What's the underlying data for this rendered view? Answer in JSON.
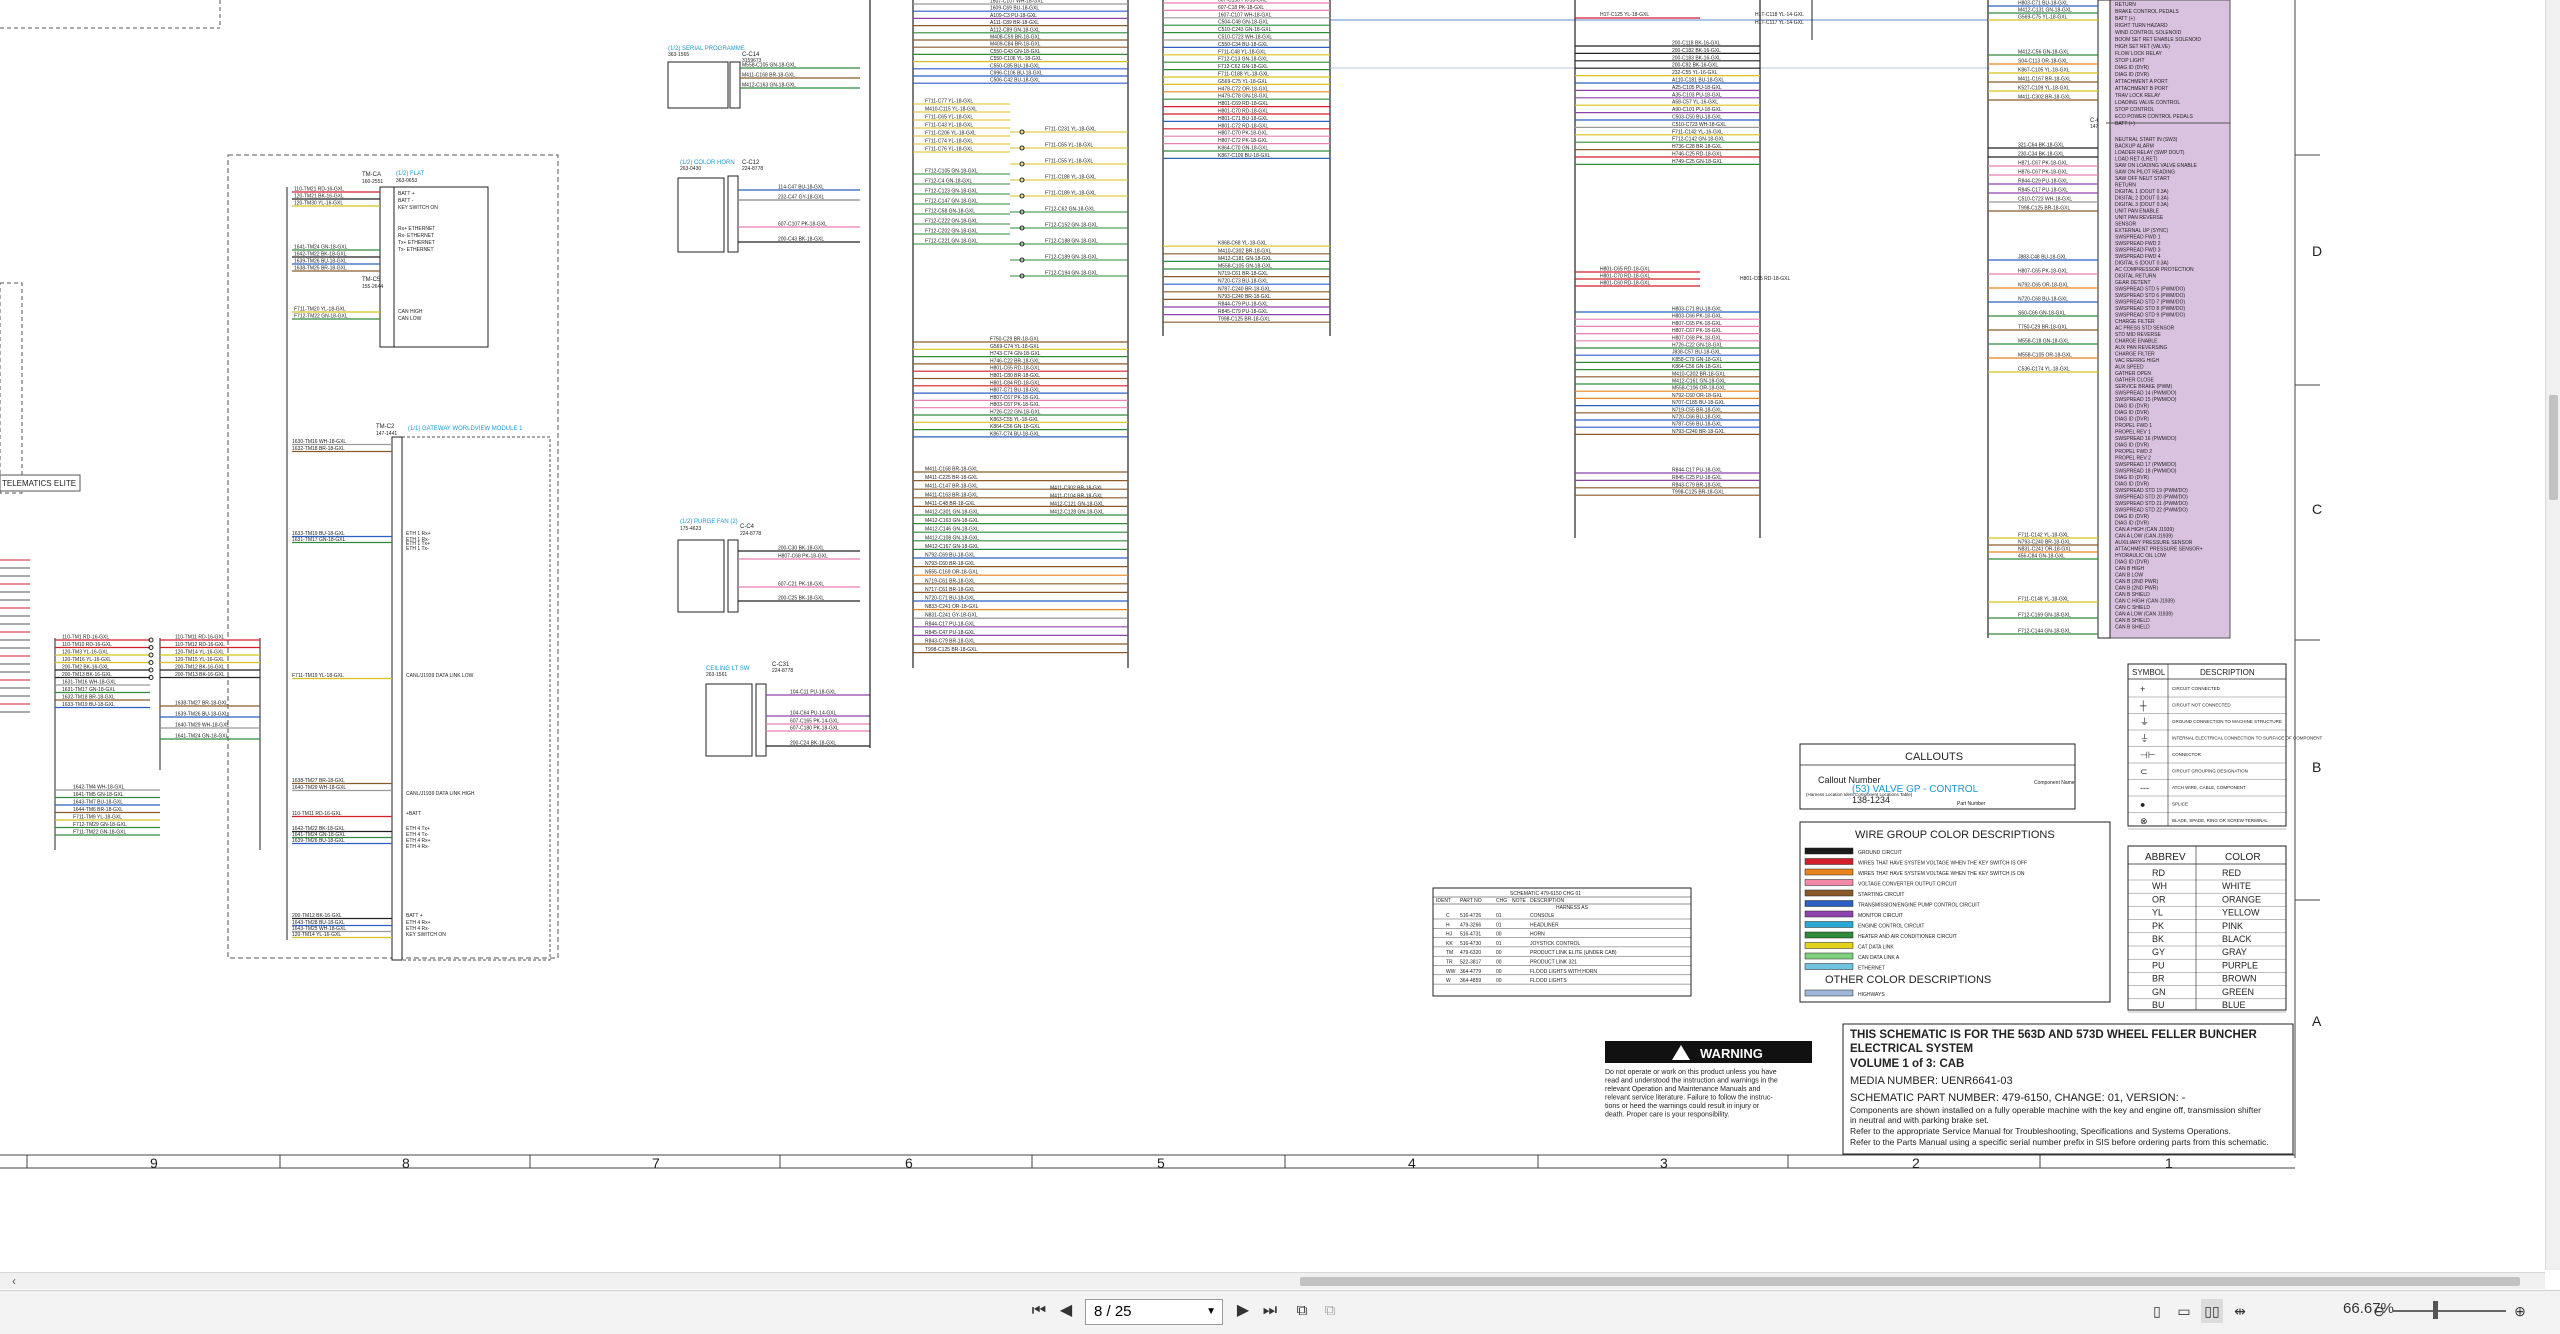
{
  "colors": {
    "purple_fill": "#d9c2df",
    "cyan_link": "#1a9ad6",
    "red_wire": "#d21f2b",
    "panel_bg": "#ffffff"
  },
  "schematic": {
    "labels": {
      "telematics": "TELEMATICS ELITE",
      "tm_ca_id": "TM-CA",
      "tm_ca_part": "160-2551",
      "tm_ca_flat": "(1/2) FLAT",
      "tm_ca_part2": "363-0653",
      "tm_c5": "TM-C5",
      "tm_c5_part": "155-2644",
      "tm_c2": "TM-C2",
      "tm_c2_part": "147-1441",
      "tm_module": "(1/1) GATEWAY WORLDVIEW MODULE 1",
      "serial_prog": "(1/2) SERIAL PROGRAMME",
      "serial_prog_part": "363-1565",
      "c14": "C-C14",
      "c14_part": "3159673",
      "color_horn": "(1/2) COLOR HORN",
      "color_horn_part": "263-0430",
      "c12": "C-C12",
      "c12_part": "224-8778",
      "purge_fan": "(1/2) PURGE FAN (2)",
      "purge_fan_part": "175-4623",
      "c4": "C-C4",
      "c4_part": "224-8778",
      "ceiling_lt": "CEILING LT SW",
      "ceiling_lt_part": "263-1561",
      "c31": "C-C31",
      "c31_part": "224-8778",
      "cs_id": "C-CS",
      "cs_part": "147-1441",
      "horn_hi": "H1T-C125 YL-18-GXL",
      "c118": "H1T-C118 YL-14-GXL",
      "c117": "H1T-C117 YL-14-GXL",
      "h801c65": "H801-C65 RD-18-GXL"
    },
    "tm_pins": [
      "BATT +",
      "BATT -",
      "KEY SWITCH ON",
      "",
      "",
      "Rx+ ETHERNET",
      "Rx- ETHERNET",
      "Tx+ ETHERNET",
      "Tx- ETHERNET"
    ],
    "tm_can": [
      "CAN HIGH",
      "CAN LOW"
    ],
    "tm_wires_top": [
      "110-TM21 RD-16-GXL",
      "120-TM21 BK-16-GXL",
      "120-TM30 YL-16-GXL"
    ],
    "tm_wires_eth": [
      "1641-TM24 GN-18-GXL",
      "1642-TM22 BK-18-GXL",
      "1639-TM26 BU-18-GXL",
      "1638-TM25 BR-18-GXL"
    ],
    "tm_wires_can": [
      "F711-TM20 YL-18-GXL",
      "F712-TM22 GN-18-GXL"
    ],
    "module_pins": [
      "CANL/J1939 DATA LINK LOW",
      "CANL/J1939 DATA LINK HIGH",
      "ETH 1 Rx+",
      "ETH 1 Rx-",
      "ETH 1 Tx+",
      "ETH 1 Tx-",
      "+BATT",
      "ETH 4 Tx+",
      "ETH 4 Tx-",
      "ETH 4 Rx+",
      "ETH 4 Rx-",
      "BATT +",
      "ETH 4 Rx+",
      "ETH 4 Rx-",
      "KEY SWITCH ON"
    ],
    "module_left_wires": [
      "1630-TM16 WH-18-GXL",
      "1632-TM18 BR-18-GXL",
      "1633-TM19 BU-18-GXL",
      "1631-TM17 GN-18-GXL",
      "F711-TM19 YL-18-GXL",
      "1638-TM27 BR-18-GXL",
      "1640-TM29 WH-18-GXL",
      "110-TM11 RD-16-GXL",
      "1642-TM22 BK-18-GXL",
      "1641-TM24 GN-18-GXL",
      "1639-TM26 BU-18-GXL",
      "200-TM12 BK-16-GXL",
      "1643-TM28 BU-18-GXL",
      "1643-TM25 WH-18-GXL",
      "120-TM14 YL-16-GXL"
    ],
    "lower_left_wires": [
      "110-TM1 RD-16-GXL",
      "110-TM10 RD-16-GXL",
      "120-TM3 YL-16-GXL",
      "120-TM16 YL-16-GXL",
      "200-TM2 BK-16-GXL",
      "200-TM13 BK-16-GXL",
      "1631-TM16 WH-18-GXL",
      "1631-TM17 GN-18-GXL",
      "1632-TM18 BR-18-GXL",
      "1633-TM19 BU-18-GXL"
    ],
    "lower_left_wires_b": [
      "1642-TM4 WH-18-GXL",
      "1641-TM5 GN-18-GXL",
      "1643-TM7 BU-18-GXL",
      "1644-TM6 BR-18-GXL",
      "F711-TM9 YL-18-GXL",
      "F712-TM29 GN-18-GXL",
      "F711-TM22 GN-18-GXL"
    ],
    "lower_left_right": [
      "110-TM11 RD-16-GXL",
      "110-TM12 RD-16-GXL",
      "120-TM14 YL-16-GXL",
      "120-TM15 YL-16-GXL",
      "200-TM12 BK-16-GXL",
      "200-TM13 BK-16-GXL",
      "1638-TM27 BR-18-GXL",
      "1639-TM26 BU-18-GXL",
      "1640-TM29 WH-18-GXL",
      "1641-TM24 GN-18-GXL"
    ],
    "serial_wires": [
      "M558-C105 GN-18-GXL",
      "M411-C168 BR-18-GXL",
      "M412-C163 GN-18-GXL"
    ],
    "horn_wires": [
      "114-C47 BU-18-GXL",
      "232-C47 GY-18-GXL",
      "607-C107 PK-18-GXL",
      "200-C43 BK-18-GXL"
    ],
    "purge_wires": [
      "200-C30 BK-18-GXL",
      "H807-C68 PK-18-GXL",
      "607-C21 PK-18-GXL",
      "200-C25 BK-18-GXL"
    ],
    "ceiling_wires": [
      "104-C11 PU-18-GXL",
      "104-C64 PU-14-GXL",
      "607-C165 PK-14-GXL",
      "607-C180 PK-18-GXL",
      "200-C24 BK-18-GXL"
    ],
    "col1_wires": [
      "1607-C107 WH-18-GXL",
      "1609-C69 BU-18-GXL",
      "A109-C3 PU-18-GXL",
      "A111-C89 BR-18-GXL",
      "A112-C89 GN-18-GXL",
      "M408-C59 BR-18-GXL",
      "M409-C84 BR-18-GXL",
      "C550-C43 GN-18-GXL",
      "C550-C106 YL-18-GXL",
      "C550-C85 BU-18-GXL",
      "C996-C106 BU-18-GXL",
      "C506-C42 BU-18-GXL"
    ],
    "col1_mid": [
      "F711-C77 YL-18-GXL",
      "M410-C115 YL-18-GXL",
      "F711-C65 YL-18-GXL",
      "F711-C43 YL-18-GXL",
      "F711-C206 YL-18-GXL",
      "F711-C74 YL-18-GXL",
      "F711-C76 YL-18-GXL",
      "F712-C105 GN-18-GXL",
      "F712-C4 GN-18-GXL",
      "F712-C123 GN-18-GXL",
      "F712-C147 GN-18-GXL",
      "F712-C58 GN-18-GXL",
      "F712-C222 GN-18-GXL",
      "F712-C202 GN-18-GXL",
      "F712-C221 GN-18-GXL"
    ],
    "col1_mid_right": [
      "F711-C231 YL-18-GXL",
      "F711-C65 YL-18-GXL",
      "F711-C55 YL-18-GXL",
      "F711-C188 YL-18-GXL",
      "F711-C189 YL-18-GXL",
      "F712-C62 GN-18-GXL",
      "F712-C152 GN-18-GXL",
      "F712-C188 GN-18-GXL",
      "F712-C189 GN-18-GXL",
      "F712-C194 GN-18-GXL"
    ],
    "col1_lower": [
      "F750-C29 BR-18-GXL",
      "G569-C74 YL-18-GXL",
      "H743-C74 GN-18-GXL",
      "H746-C22 BR-18-GXL",
      "H801-C65 RD-18-GXL",
      "H801-C80 BR-18-GXL",
      "H801-C84 RD-18-GXL",
      "H807-C71 BU-18-GXL",
      "H807-C67 PK-18-GXL",
      "H803-C67 PK-18-GXL",
      "H726-C22 GN-18-GXL",
      "K863-C55 YL-18-GXL",
      "K864-C56 GN-18-GXL",
      "K867-C74 BU-18-GXL"
    ],
    "col1_bottom": [
      "M411-C168 BR-18-GXL",
      "M411-C225 BR-18-GXL",
      "M411-C147 BR-18-GXL",
      "M411-C163 BR-18-GXL",
      "M411-C48 BR-18-GXL",
      "M412-C301 GN-18-GXL",
      "M412-C163 GN-18-GXL",
      "M412-C146 GN-18-GXL",
      "M412-C108 GN-18-GXL",
      "M412-C167 GN-18-GXL",
      "N792-C69 BU-18-GXL",
      "N793-C60 BR-18-GXL",
      "N555-C169 OR-18-GXL",
      "N719-C61 BR-18-GXL",
      "N717-C61 BR-18-GXL",
      "N720-C71 BU-18-GXL",
      "N833-C241 OR-18-GXL",
      "N831-C241 GY-18-GXL",
      "R844-C17 PU-18-GXL",
      "R845-C47 PU-18-GXL",
      "R843-C79 BR-18-GXL",
      "T998-C125 BR-18-GXL"
    ],
    "col1_bottom_right": [
      "M411-C302 BR-18-GXL",
      "M411-C104 BR-18-GXL",
      "M412-C121 GN-18-GXL",
      "M412-C128 GN-18-GXL"
    ],
    "col2_wires": [
      "607-C156 PK-18-GXL",
      "607-C18 PK-18-GXL",
      "1607-C107 WH-18-GXL",
      "C504-C48 GN-18-GXL",
      "C510-C243 GN-18-GXL",
      "C510-C723 WH-18-GXL",
      "C550-C34 BU-18-GXL",
      "F711-C48 YL-18-GXL",
      "F712-C13 GN-18-GXL",
      "F712-C62 GN-18-GXL",
      "F711-C188 YL-18-GXL",
      "G569-C75 YL-18-GXL",
      "H478-C72 OR-18-GXL",
      "H479-C78 GN-18-GXL",
      "H801-C69 RD-18-GXL",
      "H801-C70 RD-18-GXL",
      "H801-C71 BU-18-GXL",
      "H801-C72 RD-18-GXL",
      "H807-C70 PK-18-GXL",
      "H807-C72 PK-18-GXL",
      "K864-C70 GN-18-GXL",
      "K867-C109 BU-18-GXL",
      "K868-C68 YL-18-GXL",
      "M410-C302 BR-18-GXL",
      "M412-C181 GN-18-GXL",
      "M558-C105 GN-18-GXL",
      "N719-C61 BR-18-GXL",
      "N720-C73 BU-18-GXL",
      "N787-C240 BR-18-GXL",
      "N793-C240 BR-18-GXL",
      "R844-C79 PU-18-GXL",
      "R845-C79 PU-18-GXL",
      "T998-C125 BR-18-GXL"
    ],
    "col3_wires": [
      "200-C118 BK-16-GXL",
      "200-C182 BK-16-GXL",
      "200-C183 BK-16-GXL",
      "200-C92 BK-16-GXL",
      "232-C55 YL-16-GXL",
      "A110-C181 BU-18-GXL",
      "A25-C105 PU-18-GXL",
      "A35-C103 PU-18-GXL",
      "A58-C57 YL-16-GXL",
      "A90-C101 PU-18-GXL",
      "C503-C50 BU-18-GXL",
      "C510-C723 WH-18-GXL",
      "F711-C142 YL-16-GXL",
      "F712-C142 GN-18-GXL",
      "H736-C28 BR-18-GXL",
      "H746-C25 RD-18-GXL",
      "H749-C25 GN-18-GXL"
    ],
    "col3_mid": [
      "H801-C65 RD-18-GXL",
      "H801-C70 RD-18-GXL",
      "H801-C60 RD-18-GXL"
    ],
    "col3_lower": [
      "H803-C71 BU-18-GXL",
      "H803-C66 PK-18-GXL",
      "H807-C65 PK-18-GXL",
      "H807-C67 PK-18-GXL",
      "H807-C68 PK-18-GXL",
      "H726-C22 GN-18-GXL",
      "J838-C57 BU-18-GXL",
      "K858-C79 GN-18-GXL",
      "K864-C56 GN-18-GXL",
      "M410-C302 BR-18-GXL",
      "M412-C161 GN-18-GXL",
      "M558-C106 OR-18-GXL",
      "N792-C60 OR-18-GXL",
      "N707-C185 BU-18-GXL",
      "N719-C55 BR-18-GXL",
      "N720-C66 BU-18-GXL",
      "N787-C56 BU-18-GXL",
      "N793-C240 BR-18-GXL"
    ],
    "col3_bottom": [
      "R844-C17 PU-18-GXL",
      "R845-C25 PU-18-GXL",
      "R843-C79 BR-18-GXL",
      "T998-C125 BR-18-GXL"
    ],
    "cs_left_top": [
      "H803-C71 BU-18-GXL",
      "M412-C131 GN-18-GXL",
      "G569-C75 YL-18-GXL",
      "M412-C56 GN-18-GXL",
      "S04-C113 OR-18-GXL",
      "K867-C105 YL-18-GXL",
      "M411-C167 BR-18-GXL",
      "K527-C109 YL-18-GXL",
      "M411-C302 BR-18-GXL"
    ],
    "cs_left_mid": [
      "321-C64 BK-18-GXL",
      "230-C34 BK-18-GXL",
      "H871-C67 PK-18-GXL",
      "H876-C67 PK-18-GXL",
      "R844-C29 PU-18-GXL",
      "R845-C17 PU-18-GXL",
      "C510-C723 WH-18-GXL",
      "T998-C125 BR-18-GXL",
      "J883-C48 BU-18-GXL",
      "H807-C65 PK-18-GXL",
      "N792-C65 OR-18-GXL",
      "N720-C68 BU-18-GXL",
      "S60-C66 GN-18-GXL",
      "T750-C29 BR-18-GXL",
      "M558-C18 GN-18-GXL",
      "M558-C105 OR-18-GXL",
      "C536-C174 YL-18-GXL"
    ],
    "cs_left_bottom": [
      "F711-C142 YL-18-GXL",
      "N793-C240 BR-18-GXL",
      "N831-C241 OR-18-GXL",
      "456-C84 GN-18-GXL",
      "F711-C148 YL-18-GXL",
      "F712-C169 GN-18-GXL",
      "F712-C144 GN-18-GXL"
    ],
    "cs_pins_top": [
      "RETURN",
      "BRAKE CONTROL PEDALS",
      "BATT (+)",
      "RIGHT TURN HAZARD",
      "WIND CONTROL SOLENOID",
      "BOOM SET RET ENABLE SOLENOID",
      "HIGH SET RET (VALVE)",
      "FLOW LOCK RELAY",
      "STOP LIGHT",
      "DIAG ID (DVR)",
      "DIAG ID (DVR)",
      "ATTACHMENT A PORT",
      "ATTACHMENT B PORT",
      "TRAV LOCK RELAY",
      "LOADING VALVE CONTROL",
      "STOP CONTROL",
      "ECO POWER CONTROL PEDALS",
      "BATT (+)"
    ],
    "cs_pins_main": [
      "NEUTRAL START IN (SW3)",
      "BACKUP ALARM",
      "LOADER RELAY (SWP DOUT)",
      "LOAD RET (LRET)",
      "SAW ON LOADING VALVE ENABLE",
      "SAW ON PILOT READING",
      "SAW OFF NEUT START",
      "RETURN",
      "DIGITAL 1 (DOUT 0.3A)",
      "DIGITAL 2 (DOUT 0.3A)",
      "DIGITAL 3 (DOUT 0.3A)",
      "UNIT PAN ENABLE",
      "UNIT PAN REVERSE",
      "SENSOR",
      "EXTERNAL UP (SYNC)",
      "SWSPREAD FWD 1",
      "SWSPREAD FWD 2",
      "SWSPREAD FWD 3",
      "SWSPREAD FWD 4",
      "DIGITAL 5 (DOUT 0.3A)",
      "AC COMPRESSOR PROTECTION",
      "DIGITAL RETURN",
      "GEAR DETENT",
      "SWSPREAD STD 5 (PWM/DO)",
      "SWSPREAD STD 6 (PWM/DO)",
      "SWSPREAD STD 7 (PWM/DO)",
      "SWSPREAD STD 8 (PWM/DO)",
      "SWSPREAD STD 9 (PWM/DO)",
      "CHARGE FILTER",
      "AC PRESS STD SENSOR",
      "STD MID REVERSE",
      "CHARGE ENABLE",
      "AUX PAN REVERSING",
      "CHARGE FILTER",
      "VAC REFRIG HIGH",
      "AUX SPEED",
      "GATHER OPEN",
      "GATHER CLOSE",
      "SERVICE BRAKE (PWM)",
      "SWSPREAD 14 (PWM/DO)",
      "SWSPREAD 15 (PWM/DO)",
      "DIAG ID (DVR)",
      "DIAG ID (DVR)",
      "DIAG ID (DVR)",
      "PROPEL FWD 1",
      "PROPEL REV 1",
      "SWSPREAD 16 (PWM/DO)",
      "DIAG ID (DVR)",
      "PROPEL FWD 2",
      "PROPEL REV 2",
      "SWSPREAD 17 (PWM/DO)",
      "SWSPREAD 18 (PWM/DO)",
      "DIAG ID (DVR)",
      "DIAG ID (DVR)",
      "SWSPREAD STD 19 (PWM/DO)",
      "SWSPREAD STD 20 (PWM/DO)",
      "SWSPREAD STD 21 (PWM/DO)",
      "SWSPREAD STD 22 (PWM/DO)",
      "DIAG ID (DVR)",
      "DIAG ID (DVR)",
      "CAN A HIGH (CAN J1939)",
      "CAN A LOW (CAN J1939)",
      "AUXILIARY PRESSURE SENSOR",
      "ATTACHMENT PRESSURE SENSOR+",
      "HYDRAULIC OIL LOW",
      "DIAG ID (DVR)",
      "CAN B HIGH",
      "CAN B LOW",
      "CAN B (2ND PWR)",
      "CAN B (2ND PWR)",
      "CAN B SHIELD",
      "CAN C HIGH (CAN J1939)",
      "CAN C SHIELD",
      "CAN A LOW (CAN J1939)",
      "CAN B SHIELD",
      "CAN B SHIELD"
    ]
  },
  "harness_table": {
    "title": "SCHEMATIC 479-6150 CHG 01",
    "headers": [
      "IDENT",
      "PART NO",
      "CHG",
      "NOTE",
      "DESCRIPTION"
    ],
    "subheader": "HARNESS AS",
    "rows": [
      [
        "C",
        "516-4726",
        "01",
        "",
        "CONSOLE"
      ],
      [
        "H",
        "479-3266",
        "01",
        "",
        "HEADLINER"
      ],
      [
        "HJ",
        "516-4731",
        "00",
        "",
        "HORN"
      ],
      [
        "KK",
        "516-4730",
        "01",
        "",
        "JOYSTICK CONTROL"
      ],
      [
        "TM",
        "479-6320",
        "00",
        "",
        "PRODUCT LINK ELITE (UNDER CAB)"
      ],
      [
        "TR",
        "522-3817",
        "00",
        "",
        "PRODUCT LINK 321"
      ],
      [
        "WW",
        "364-4779",
        "00",
        "",
        "FLOOD LIGHTS WITH HORN"
      ],
      [
        "W",
        "364-4859",
        "00",
        "",
        "FLOOD LIGHTS"
      ]
    ]
  },
  "callouts": {
    "title": "CALLOUTS",
    "callout_number": "Callout Number",
    "callout_sub": "(Harness Location Ident Component Locations Table)",
    "example_link": "(53) VALVE GP - CONTROL",
    "example_part": "138-1234",
    "component_name": "Component Name",
    "part_number": "Part Number"
  },
  "wire_colors": {
    "title": "WIRE GROUP COLOR DESCRIPTIONS",
    "items": [
      {
        "color": "#1a1a1a",
        "label": "GROUND CIRCUIT"
      },
      {
        "color": "#d21f2b",
        "label": "WIRES THAT HAVE SYSTEM VOLTAGE WHEN THE KEY SWITCH IS OFF"
      },
      {
        "color": "#e8841a",
        "label": "WIRES THAT HAVE SYSTEM VOLTAGE WHEN THE KEY SWITCH IS ON"
      },
      {
        "color": "#f08aa8",
        "label": "VOLTAGE CONVERTER OUTPUT CIRCUIT"
      },
      {
        "color": "#8a5a2b",
        "label": "STARTING CIRCUIT"
      },
      {
        "color": "#2b5fc2",
        "label": "TRANSMISSION/ENGINE PUMP CONTROL CIRCUIT"
      },
      {
        "color": "#8e44ad",
        "label": "MONITOR CIRCUIT"
      },
      {
        "color": "#2aa9d6",
        "label": "ENGINE CONTROL CIRCUIT"
      },
      {
        "color": "#2e8b3a",
        "label": "HEATER AND AIR CONDITIONER CIRCUIT"
      },
      {
        "color": "#e3d21a",
        "label": "CAT DATA LINK"
      },
      {
        "color": "#7ed17e",
        "label": "CAN DATA LINK A"
      },
      {
        "color": "#6fc3df",
        "label": "ETHERNET"
      }
    ],
    "other_title": "OTHER COLOR DESCRIPTIONS",
    "other_items": [
      {
        "color": "#9fb6d8",
        "label": "HIGHWAYS"
      }
    ]
  },
  "symbols": {
    "headers": [
      "SYMBOL",
      "DESCRIPTION"
    ],
    "rows": [
      {
        "glyph": "+",
        "label": "CIRCUIT CONNECTED"
      },
      {
        "glyph": "┼",
        "label": "CIRCUIT NOT CONNECTED"
      },
      {
        "glyph": "⏚",
        "label": "GROUND CONNECTION TO MACHINE STRUCTURE"
      },
      {
        "glyph": "⏚",
        "label": "INTERNAL ELECTRICAL CONNECTION TO SURFACE OF COMPONENT"
      },
      {
        "glyph": "⊣⊢",
        "label": "CONNECTOR"
      },
      {
        "glyph": "⊂",
        "label": "CIRCUIT GROUPING DESIGNATION"
      },
      {
        "glyph": "---",
        "label": "ATCH WIRE, CABLE, COMPONENT"
      },
      {
        "glyph": "●",
        "label": "SPLICE"
      },
      {
        "glyph": "⊗",
        "label": "BLADE, SPADE, RING OR SCREW TERMINAL"
      }
    ]
  },
  "abbrev": {
    "headers": [
      "ABBREV",
      "COLOR"
    ],
    "rows": [
      [
        "RD",
        "RED"
      ],
      [
        "WH",
        "WHITE"
      ],
      [
        "OR",
        "ORANGE"
      ],
      [
        "YL",
        "YELLOW"
      ],
      [
        "PK",
        "PINK"
      ],
      [
        "BK",
        "BLACK"
      ],
      [
        "GY",
        "GRAY"
      ],
      [
        "PU",
        "PURPLE"
      ],
      [
        "BR",
        "BROWN"
      ],
      [
        "GN",
        "GREEN"
      ],
      [
        "BU",
        "BLUE"
      ]
    ]
  },
  "warning": {
    "title": "WARNING",
    "lines": [
      "Do not operate or work on this product unless you have",
      "read and understood the instruction and warnings in the",
      "relevant Operation and Maintenance Manuals and",
      "relevant service literature. Failure to follow the instruc-",
      "tions or heed the warnings could result in injury or",
      "death. Proper care is your responsibility."
    ]
  },
  "title_block": {
    "line1": "THIS SCHEMATIC IS FOR THE 563D AND 573D WHEEL FELLER BUNCHER",
    "line2": "ELECTRICAL SYSTEM",
    "line3": "VOLUME 1 of 3: CAB",
    "media": "MEDIA NUMBER:  UENR6641-03",
    "part": "SCHEMATIC PART NUMBER: 479-6150, CHANGE: 01, VERSION: -",
    "note1": "Components are shown installed on a fully operable machine with the key and engine off, transmission shifter",
    "note2": "in neutral and with parking brake set.",
    "note3": "Refer to the appropriate Service Manual for Troubleshooting, Specifications and Systems Operations.",
    "note4": "Refer to the Parts Manual using a specific serial number prefix in SIS before ordering parts from this schematic."
  },
  "grid": {
    "columns": [
      "9",
      "8",
      "7",
      "6",
      "5",
      "4",
      "3",
      "2",
      "1"
    ],
    "rows": [
      "D",
      "C",
      "B",
      "A"
    ]
  },
  "viewer": {
    "page_value": "8 / 25",
    "zoom": "66.67%",
    "first_icon": "first-page-icon",
    "prev_icon": "prev-page-icon"
  }
}
